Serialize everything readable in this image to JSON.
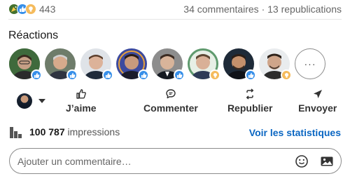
{
  "summary": {
    "reaction_count": "443",
    "comments": "34 commentaires",
    "separator": " · ",
    "reposts": "13 republications",
    "icons": [
      "celebrate-icon",
      "like-icon",
      "insightful-icon"
    ]
  },
  "reactions": {
    "title": "Réactions",
    "people": [
      {
        "name": "reactor-1",
        "badge": "like",
        "skin": "#c69f86",
        "hair": "#3a2a1e",
        "bg": "#3f6a3c"
      },
      {
        "name": "reactor-2",
        "badge": "like",
        "skin": "#d7aa8c",
        "hair": "#cfcfcf",
        "bg": "#6e7c6a"
      },
      {
        "name": "reactor-3",
        "badge": "like",
        "skin": "#dcb299",
        "hair": "#5a3d2b",
        "bg": "#dfe3e8"
      },
      {
        "name": "reactor-4",
        "badge": "like",
        "skin": "#c89a7d",
        "hair": "#2a1d16",
        "bg": "#3c4a9e"
      },
      {
        "name": "reactor-5",
        "badge": "like",
        "skin": "#d8b49a",
        "hair": "#3b2b22",
        "bg": "#8d8d8d"
      },
      {
        "name": "reactor-6",
        "badge": "insightful",
        "skin": "#d9b097",
        "hair": "#5d4632",
        "bg": "#5f9a6e"
      },
      {
        "name": "reactor-7",
        "badge": "like",
        "skin": "#c4906c",
        "hair": "#2b1e17",
        "bg": "#1e2a38"
      },
      {
        "name": "reactor-8",
        "badge": "insightful",
        "skin": "#cfa58a",
        "hair": "#2f231b",
        "bg": "#e9ecee"
      }
    ],
    "more_label": "···"
  },
  "actions": {
    "like": "J’aime",
    "comment": "Commenter",
    "repost": "Republier",
    "send": "Envoyer"
  },
  "impressions": {
    "count": "100 787",
    "label": " impressions",
    "stats_link": "Voir les statistiques"
  },
  "comment": {
    "placeholder": "Ajouter un commentaire…"
  },
  "colors": {
    "accent": "#0a66c2",
    "like_badge": "#378fe9",
    "insightful_badge": "#f5bb5c",
    "celebrate_badge": "#44712e"
  }
}
